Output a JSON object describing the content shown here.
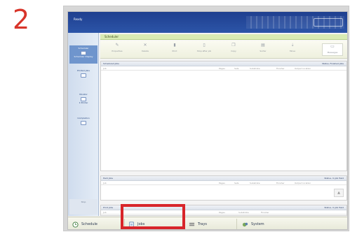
{
  "step_number": "2",
  "window": {
    "title": "Ready"
  },
  "sidebar": {
    "items": [
      {
        "label": "Scheduler",
        "sub": "Scheduler Display",
        "active": true
      },
      {
        "label": "Printed Jobs",
        "sub": "",
        "active": false
      },
      {
        "label": "Monitor",
        "sub": "1 Printer",
        "active": false
      },
      {
        "label": "Completion",
        "sub": "",
        "active": false
      }
    ],
    "lower_label": "Stop"
  },
  "main": {
    "header": "Scheduler",
    "toolbar": [
      {
        "icon": "pencil-icon",
        "label": "Properties"
      },
      {
        "icon": "delete-icon",
        "label": "Delete"
      },
      {
        "icon": "print-icon",
        "label": "Print"
      },
      {
        "icon": "stop-icon",
        "label": "Stop after job"
      },
      {
        "icon": "copy-icon",
        "label": "Copy"
      },
      {
        "icon": "sort-icon",
        "label": "Sorter"
      },
      {
        "icon": "move-icon",
        "label": "Move"
      }
    ],
    "toolbar_right": "Messages",
    "sections": [
      {
        "title": "Scheduled Jobs",
        "right": "Status, Finished Jobs",
        "columns": [
          "Job",
          "Pages",
          "Sets",
          "Substrate",
          "Finisher",
          "Output location"
        ]
      },
      {
        "title": "Held Jobs",
        "right": "Status, In Job Held",
        "columns": [
          "Job",
          "Pages",
          "Sets",
          "Substrate",
          "Finisher",
          "Output location"
        ]
      },
      {
        "title": "Print Jobs",
        "right": "Status, In Job Held",
        "columns": [
          "Job",
          "Pages",
          "Substrate",
          "Finisher"
        ]
      }
    ]
  },
  "bottom_nav": [
    {
      "label": "Schedule",
      "icon": "clock-icon"
    },
    {
      "label": "Jobs",
      "icon": "jobs-icon"
    },
    {
      "label": "Trays",
      "icon": "trays-icon"
    },
    {
      "label": "System",
      "icon": "system-icon"
    }
  ],
  "colors": {
    "step": "#d8352a",
    "highlight": "#d8252a",
    "titlebar": "#2c55a8",
    "sidebar_active": "#6f95cd"
  }
}
